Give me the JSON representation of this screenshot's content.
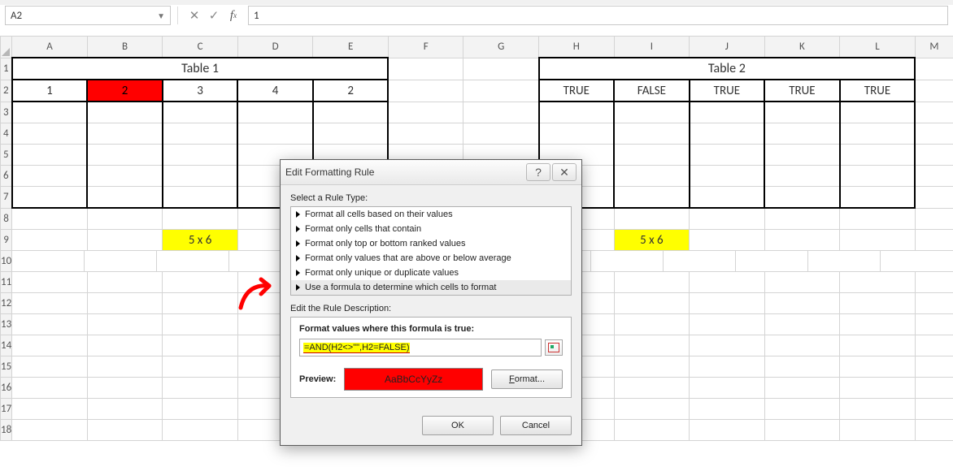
{
  "namebox": {
    "cell_ref": "A2"
  },
  "formula_bar": {
    "value": "1"
  },
  "columns": [
    "A",
    "B",
    "C",
    "D",
    "E",
    "F",
    "G",
    "H",
    "I",
    "J",
    "K",
    "L",
    "M"
  ],
  "row_numbers": [
    "1",
    "2",
    "3",
    "4",
    "5",
    "6",
    "7",
    "8",
    "9",
    "10",
    "11",
    "12",
    "13",
    "14",
    "15",
    "16",
    "17",
    "18"
  ],
  "titles": {
    "table1": "Table 1",
    "table2": "Table 2"
  },
  "t1_row": {
    "a": "1",
    "b": "2",
    "c": "3",
    "d": "4",
    "e": "2"
  },
  "t2_row": {
    "h": "TRUE",
    "i": "FALSE",
    "j": "TRUE",
    "k": "TRUE",
    "l": "TRUE"
  },
  "dim_label": {
    "left": "5 x 6",
    "right": "5 x 6"
  },
  "dialog": {
    "title": "Edit Formatting Rule",
    "section_select": "Select a Rule Type:",
    "rule_types": [
      "Format all cells based on their values",
      "Format only cells that contain",
      "Format only top or bottom ranked values",
      "Format only values that are above or below average",
      "Format only unique or duplicate values",
      "Use a formula to determine which cells to format"
    ],
    "section_desc": "Edit the Rule Description:",
    "formula_label": "Format values where this formula is true:",
    "formula_value": "=AND(H2<>\"\",H2=FALSE)",
    "preview_label": "Preview:",
    "preview_sample": "AaBbCcYyZz",
    "format_btn": "Format...",
    "ok": "OK",
    "cancel": "Cancel"
  }
}
